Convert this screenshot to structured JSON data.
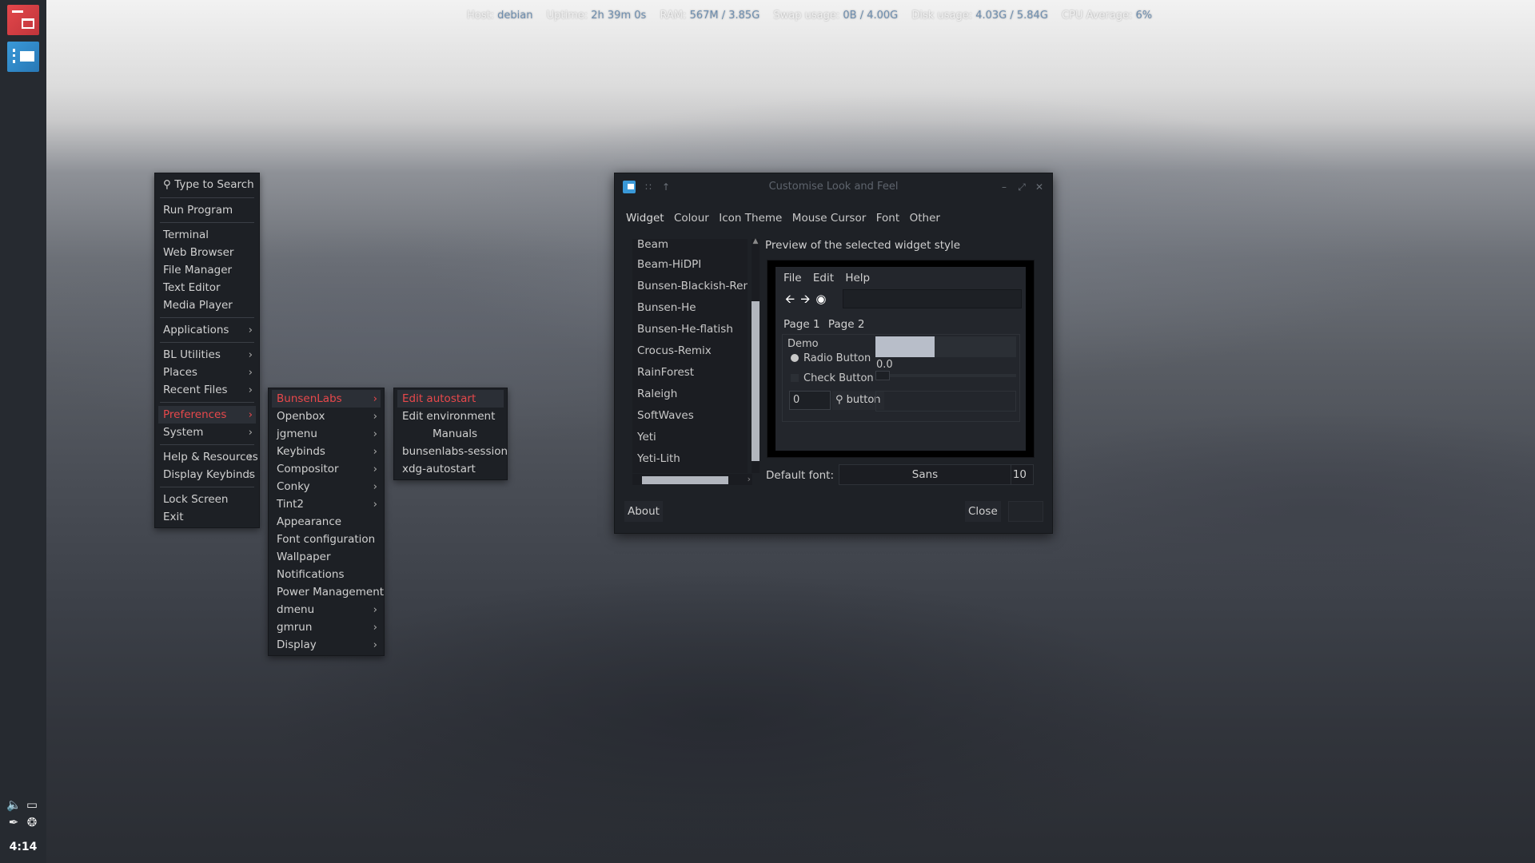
{
  "conky": {
    "host_label": "Host:",
    "host": "debian",
    "uptime_label": "Uptime:",
    "uptime": "2h 39m 0s",
    "ram_label": "RAM:",
    "ram": "567M / 3.85G",
    "swap_label": "Swap usage:",
    "swap": "0B / 4.00G",
    "disk_label": "Disk usage:",
    "disk": "4.03G / 5.84G",
    "cpu_label": "CPU Average:",
    "cpu": "6%"
  },
  "panel": {
    "clock": "4:14",
    "tray_icons": [
      "speaker-icon",
      "display-icon",
      "paperclip-icon",
      "network-icon"
    ]
  },
  "root_menu": {
    "search_placeholder": "Type to Search",
    "items": [
      {
        "label": "Run Program"
      },
      {
        "label": "Terminal"
      },
      {
        "label": "Web Browser"
      },
      {
        "label": "File Manager"
      },
      {
        "label": "Text Editor"
      },
      {
        "label": "Media Player"
      },
      {
        "label": "Applications"
      },
      {
        "label": "BL Utilities"
      },
      {
        "label": "Places"
      },
      {
        "label": "Recent Files"
      },
      {
        "label": "Preferences"
      },
      {
        "label": "System"
      },
      {
        "label": "Help & Resources"
      },
      {
        "label": "Display Keybinds"
      },
      {
        "label": "Lock Screen"
      },
      {
        "label": "Exit"
      }
    ]
  },
  "preferences_menu": {
    "items": [
      {
        "label": "BunsenLabs"
      },
      {
        "label": "Openbox"
      },
      {
        "label": "jgmenu"
      },
      {
        "label": "Keybinds"
      },
      {
        "label": "Compositor"
      },
      {
        "label": "Conky"
      },
      {
        "label": "Tint2"
      },
      {
        "label": "Appearance"
      },
      {
        "label": "Font configuration"
      },
      {
        "label": "Wallpaper"
      },
      {
        "label": "Notifications"
      },
      {
        "label": "Power Management"
      },
      {
        "label": "dmenu"
      },
      {
        "label": "gmrun"
      },
      {
        "label": "Display"
      }
    ]
  },
  "bunsenlabs_menu": {
    "items": [
      {
        "label": "Edit autostart"
      },
      {
        "label": "Edit environment"
      },
      {
        "label": "Manuals"
      },
      {
        "label": "bunsenlabs-session"
      },
      {
        "label": "xdg-autostart"
      }
    ]
  },
  "window": {
    "title": "Customise Look and Feel",
    "tabs": [
      "Widget",
      "Colour",
      "Icon Theme",
      "Mouse Cursor",
      "Font",
      "Other"
    ],
    "themes": [
      "Beam",
      "Beam-HiDPI",
      "Bunsen-Blackish-Remix",
      "Bunsen-He",
      "Bunsen-He-flatish",
      "Crocus-Remix",
      "RainForest",
      "Raleigh",
      "SoftWaves",
      "Yeti",
      "Yeti-Lith"
    ],
    "preview_label": "Preview of the selected widget style",
    "preview": {
      "menu": [
        "File",
        "Edit",
        "Help"
      ],
      "pages": [
        "Page 1",
        "Page 2"
      ],
      "demo_label": "Demo",
      "radio_label": "Radio Button",
      "check_label": "Check Button",
      "scale_value": "0.0",
      "spin_value": "0",
      "button_label": "button",
      "progress_fraction": 0.42
    },
    "font_label": "Default font:",
    "font_name": "Sans",
    "font_size": "10",
    "about_label": "About",
    "close_label": "Close"
  },
  "colors": {
    "menu_active": "#e8484b",
    "conky_value": "#6f8fb0",
    "panel_bg": "#262a30"
  }
}
